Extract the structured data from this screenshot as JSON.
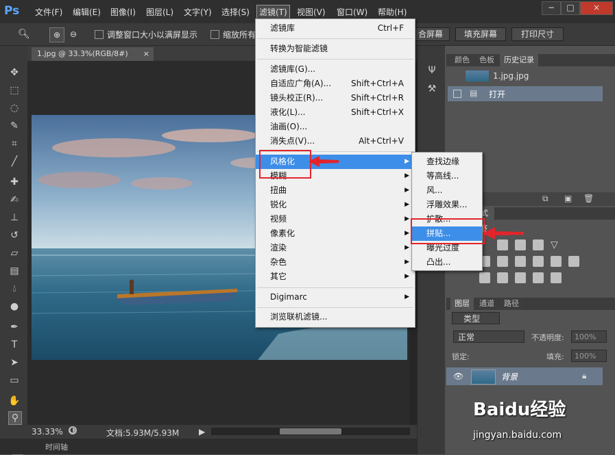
{
  "menubar": {
    "logo": "Ps",
    "items": [
      "文件(F)",
      "编辑(E)",
      "图像(I)",
      "图层(L)",
      "文字(Y)",
      "选择(S)",
      "滤镜(T)",
      "视图(V)",
      "窗口(W)",
      "帮助(H)"
    ],
    "active": "滤镜(T)",
    "window_min": "−",
    "window_max": "□",
    "window_close": "×"
  },
  "options": {
    "check1": "调整窗口大小以满屏显示",
    "check2": "缩放所有",
    "btn_fit": "合屏幕",
    "btn_fill": "填充屏幕",
    "btn_print": "打印尺寸"
  },
  "document": {
    "tab": "1.jpg @ 33.3%(RGB/8#)",
    "tab_close": "×"
  },
  "status": {
    "zoom": "33.33%",
    "doc": "文档:5.93M/5.93M",
    "timeline": "时间轴"
  },
  "filter_menu": {
    "items": [
      {
        "label": "滤镜库",
        "shortcut": "Ctrl+F"
      },
      {
        "label": "转换为智能滤镜",
        "shortcut": ""
      },
      {
        "label": "滤镜库(G)...",
        "shortcut": ""
      },
      {
        "label": "自适应广角(A)...",
        "shortcut": "Shift+Ctrl+A"
      },
      {
        "label": "镜头校正(R)...",
        "shortcut": "Shift+Ctrl+R"
      },
      {
        "label": "液化(L)...",
        "shortcut": "Shift+Ctrl+X"
      },
      {
        "label": "油画(O)...",
        "shortcut": ""
      },
      {
        "label": "消失点(V)...",
        "shortcut": "Alt+Ctrl+V"
      },
      {
        "label": "风格化",
        "shortcut": ""
      },
      {
        "label": "模糊",
        "shortcut": ""
      },
      {
        "label": "扭曲",
        "shortcut": ""
      },
      {
        "label": "锐化",
        "shortcut": ""
      },
      {
        "label": "视频",
        "shortcut": ""
      },
      {
        "label": "像素化",
        "shortcut": ""
      },
      {
        "label": "渲染",
        "shortcut": ""
      },
      {
        "label": "杂色",
        "shortcut": ""
      },
      {
        "label": "其它",
        "shortcut": ""
      },
      {
        "label": "Digimarc",
        "shortcut": ""
      },
      {
        "label": "浏览联机滤镜...",
        "shortcut": ""
      }
    ],
    "submenu_arrow": "▶"
  },
  "stylize_menu": {
    "items": [
      "查找边缘",
      "等高线...",
      "风...",
      "浮雕效果...",
      "扩散...",
      "拼贴...",
      "曝光过度",
      "凸出..."
    ],
    "highlighted": "拼贴..."
  },
  "history_panel": {
    "tabs": [
      "颜色",
      "色板",
      "历史记录"
    ],
    "snapshot": "1.jpg.jpg",
    "step": "打开"
  },
  "adjust_panel": {
    "tab": "样式",
    "partial_label": "整"
  },
  "layers_panel": {
    "tabs": [
      "图层",
      "通道",
      "路径"
    ],
    "filter_kind": "类型",
    "blend_mode": "正常",
    "opacity_label": "不透明度:",
    "opacity_value": "100%",
    "lock_label": "锁定:",
    "fill_label": "填充:",
    "fill_value": "100%",
    "layer_name": "背景"
  },
  "watermark": {
    "brand": "Baidu经验",
    "url": "jingyan.baidu.com"
  },
  "colors": {
    "highlight": "#3d8ee8",
    "callout": "#e3242b"
  }
}
